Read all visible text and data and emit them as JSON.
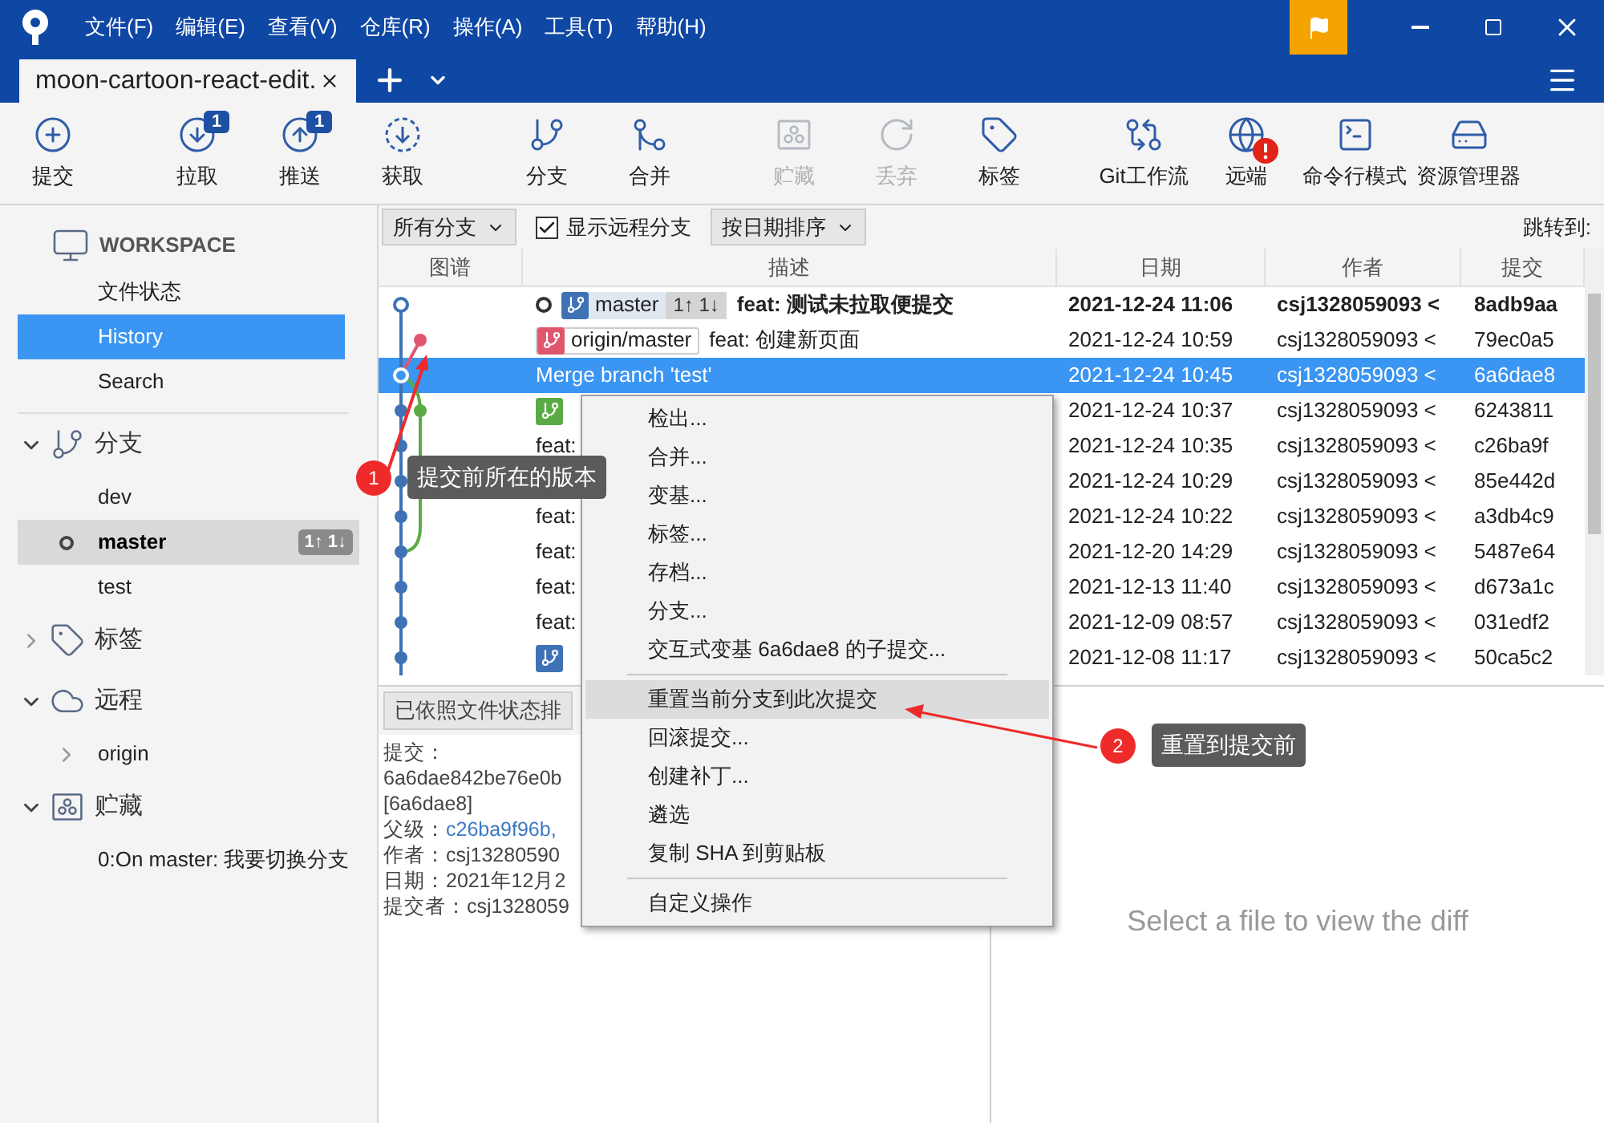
{
  "title_bar": {
    "menus": [
      "文件(F)",
      "编辑(E)",
      "查看(V)",
      "仓库(R)",
      "操作(A)",
      "工具(T)",
      "帮助(H)"
    ]
  },
  "tabs": [
    {
      "label": "moon-cartoon-react-edit.",
      "selected": true
    }
  ],
  "toolbar": {
    "groups": [
      [
        {
          "kind": "commit",
          "label": "提交",
          "disabled": false
        }
      ],
      [
        {
          "kind": "pull",
          "label": "拉取",
          "disabled": false,
          "badge": "1"
        },
        {
          "kind": "push",
          "label": "推送",
          "disabled": false,
          "badge": "1"
        },
        {
          "kind": "fetch",
          "label": "获取",
          "disabled": false
        }
      ],
      [
        {
          "kind": "branch",
          "label": "分支",
          "disabled": false
        },
        {
          "kind": "merge",
          "label": "合并",
          "disabled": false
        }
      ],
      [
        {
          "kind": "stash",
          "label": "贮藏",
          "disabled": true
        },
        {
          "kind": "discard",
          "label": "丢弃",
          "disabled": true
        },
        {
          "kind": "tag",
          "label": "标签",
          "disabled": false
        }
      ],
      [
        {
          "kind": "flow",
          "label": "Git工作流",
          "disabled": false
        },
        {
          "kind": "remote",
          "label": "远端",
          "disabled": false,
          "alert": true
        },
        {
          "kind": "terminal",
          "label": "命令行模式",
          "disabled": false
        },
        {
          "kind": "explorer",
          "label": "资源管理器",
          "disabled": false
        }
      ]
    ]
  },
  "sidebar": {
    "workspace": {
      "title": "WORKSPACE",
      "items": [
        {
          "label": "文件状态",
          "selected": false
        },
        {
          "label": "History",
          "selected": true
        },
        {
          "label": "Search",
          "selected": false
        }
      ]
    },
    "sections": [
      {
        "kind": "branches",
        "title": "分支",
        "expanded": true,
        "children": [
          {
            "label": "dev",
            "current": false,
            "selected": false
          },
          {
            "label": "master",
            "current": true,
            "selected": true,
            "badge": "1↑ 1↓"
          },
          {
            "label": "test",
            "current": false,
            "selected": false
          }
        ]
      },
      {
        "kind": "tags",
        "title": "标签",
        "expanded": false
      },
      {
        "kind": "remotes",
        "title": "远程",
        "expanded": true,
        "children": [
          {
            "label": "origin",
            "current": false,
            "selected": false,
            "expanded": false
          }
        ]
      },
      {
        "kind": "stashes",
        "title": "贮藏",
        "expanded": true,
        "children": [
          {
            "label": "0:On master: 我要切换分支",
            "current": false,
            "selected": false
          }
        ]
      }
    ]
  },
  "filter_bar": {
    "branch_filter": "所有分支",
    "show_remote": {
      "label": "显示远程分支",
      "checked": true
    },
    "sort": "按日期排序",
    "jump_label": "跳转到:"
  },
  "history": {
    "columns": [
      "图谱",
      "描述",
      "日期",
      "作者",
      "提交"
    ],
    "rows": [
      {
        "selected": false,
        "bold": true,
        "current": true,
        "refs": [
          {
            "kind": "local",
            "label": "master",
            "color": "#3f72b5"
          }
        ],
        "ahead_behind": "1↑ 1↓",
        "description": "feat: 测试未拉取便提交",
        "date": "2021-12-24 11:06",
        "author": "csj1328059093 <",
        "commit": "8adb9aa"
      },
      {
        "selected": false,
        "bold": false,
        "current": false,
        "refs": [
          {
            "kind": "remote",
            "label": "origin/master",
            "color": "#e0566f"
          }
        ],
        "description": "feat: 创建新页面",
        "date": "2021-12-24 10:59",
        "author": "csj1328059093 <",
        "commit": "79ec0a5"
      },
      {
        "selected": true,
        "bold": false,
        "current": false,
        "description": "Merge branch 'test'",
        "date": "2021-12-24 10:45",
        "author": "csj1328059093 <",
        "commit": "6a6dae8"
      },
      {
        "selected": false,
        "bold": false,
        "current": false,
        "refs": [
          {
            "kind": "local",
            "color": "#5aab46"
          }
        ],
        "date": "2021-12-24 10:37",
        "author": "csj1328059093 <",
        "commit": "6243811"
      },
      {
        "selected": false,
        "bold": false,
        "current": false,
        "description": "feat:",
        "date": "2021-12-24 10:35",
        "author": "csj1328059093 <",
        "commit": "c26ba9f"
      },
      {
        "selected": false,
        "bold": false,
        "current": false,
        "date": "2021-12-24 10:29",
        "author": "csj1328059093 <",
        "commit": "85e442d"
      },
      {
        "selected": false,
        "bold": false,
        "current": false,
        "description": "feat:",
        "date": "2021-12-24 10:22",
        "author": "csj1328059093 <",
        "commit": "a3db4c9"
      },
      {
        "selected": false,
        "bold": false,
        "current": false,
        "description": "feat:",
        "date": "2021-12-20 14:29",
        "author": "csj1328059093 <",
        "commit": "5487e64"
      },
      {
        "selected": false,
        "bold": false,
        "current": false,
        "description": "feat:",
        "date": "2021-12-13 11:40",
        "author": "csj1328059093 <",
        "commit": "d673a1c"
      },
      {
        "selected": false,
        "bold": false,
        "current": false,
        "description": "feat:",
        "date": "2021-12-09 08:57",
        "author": "csj1328059093 <",
        "commit": "031edf2"
      },
      {
        "selected": false,
        "bold": false,
        "current": false,
        "refs": [
          {
            "kind": "local",
            "color": "#3f72b5"
          }
        ],
        "date": "2021-12-08 11:17",
        "author": "csj1328059093 <",
        "commit": "50ca5c2"
      }
    ]
  },
  "details": {
    "sort_button": "已依照文件状态排",
    "lines": [
      {
        "text": "提交："
      },
      {
        "text": "6a6dae842be76e0b"
      },
      {
        "text": "[6a6dae8]"
      },
      {
        "label": "父级：",
        "link": "c26ba9f96b,"
      },
      {
        "label": "作者：",
        "text": "csj13280590"
      },
      {
        "label": "日期：",
        "text": "2021年12月2"
      },
      {
        "label": "提交者：",
        "text": "csj1328059"
      }
    ]
  },
  "diff": {
    "placeholder": "Select a file to view the diff"
  },
  "context_menu": {
    "items": [
      {
        "kind": "item",
        "label": "检出...",
        "selected": false
      },
      {
        "kind": "item",
        "label": "合并...",
        "selected": false
      },
      {
        "kind": "item",
        "label": "变基...",
        "selected": false
      },
      {
        "kind": "item",
        "label": "标签...",
        "selected": false
      },
      {
        "kind": "item",
        "label": "存档...",
        "selected": false
      },
      {
        "kind": "item",
        "label": "分支...",
        "selected": false
      },
      {
        "kind": "item",
        "label": "交互式变基 6a6dae8 的子提交...",
        "selected": false
      },
      {
        "kind": "separator"
      },
      {
        "kind": "item",
        "label": "重置当前分支到此次提交",
        "selected": true
      },
      {
        "kind": "item",
        "label": "回滚提交...",
        "selected": false
      },
      {
        "kind": "item",
        "label": "创建补丁...",
        "selected": false
      },
      {
        "kind": "item",
        "label": "遴选",
        "selected": false
      },
      {
        "kind": "item",
        "label": "复制 SHA 到剪贴板",
        "selected": false
      },
      {
        "kind": "separator"
      },
      {
        "kind": "item",
        "label": "自定义操作",
        "selected": false
      }
    ]
  },
  "annotations": [
    {
      "number": "1",
      "text": "提交前所在的版本"
    },
    {
      "number": "2",
      "text": "重置到提交前"
    }
  ]
}
